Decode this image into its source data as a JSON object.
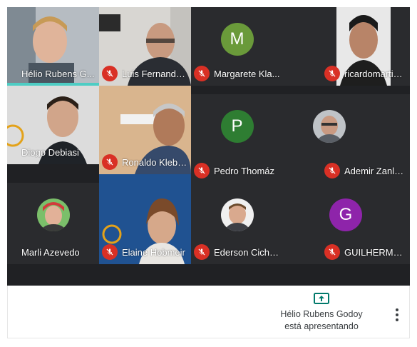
{
  "participants": [
    {
      "name": "Hélio Rubens G...",
      "muted": false,
      "kind": "video"
    },
    {
      "name": "Luis Fernando ...",
      "muted": true,
      "kind": "video"
    },
    {
      "name": "Margarete Kla...",
      "muted": true,
      "kind": "letter",
      "letter": "M",
      "color": "#6a9a3a"
    },
    {
      "name": "ricardomartins...",
      "muted": true,
      "kind": "video"
    },
    {
      "name": "Diogo Debiasi",
      "muted": true,
      "kind": "video"
    },
    {
      "name": "Ronaldo Kleber...",
      "muted": true,
      "kind": "video"
    },
    {
      "name": "Pedro Thomáz",
      "muted": true,
      "kind": "letter",
      "letter": "P",
      "color": "#2e7d32"
    },
    {
      "name": "Ademir Zanlore...",
      "muted": true,
      "kind": "photo"
    },
    {
      "name": "Marli Azevedo",
      "muted": true,
      "kind": "photo"
    },
    {
      "name": "Elaine Hobmeir",
      "muted": true,
      "kind": "video"
    },
    {
      "name": "Ederson Cicha...",
      "muted": true,
      "kind": "photo"
    },
    {
      "name": "GUILHERME N...",
      "muted": true,
      "kind": "letter",
      "letter": "G",
      "color": "#8e24aa"
    }
  ],
  "presenting": {
    "line1": "Hélio Rubens Godoy",
    "line2": "está apresentando"
  },
  "icons": {
    "mic_off": "mic-off-icon",
    "present": "present-screen-icon",
    "more": "more-vert-icon"
  },
  "colors": {
    "mic_off_bg": "#d93025",
    "present_icon": "#00796b",
    "speaking_indicator": "#4ecdc4"
  }
}
